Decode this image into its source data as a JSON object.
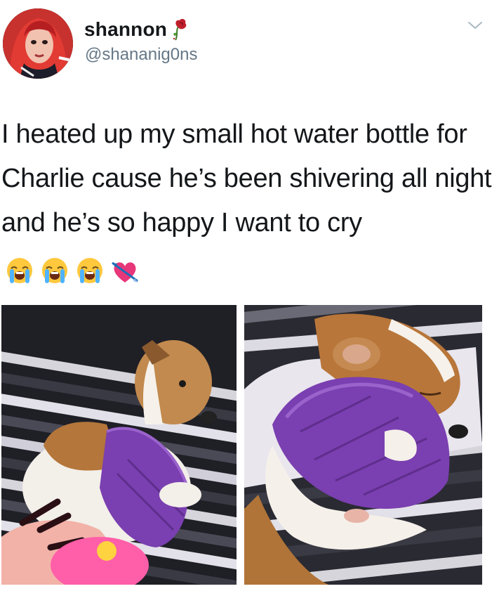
{
  "tweet": {
    "display_name": "shannon",
    "handle": "@shananig0ns",
    "text": "I heated up my small hot water bottle for Charlie cause he’s been shivering all night and he’s so happy I want to cry"
  },
  "icons": {
    "name_emoji": "rose-icon",
    "menu": "chevron-down-icon",
    "emojis": [
      "loudly-crying-face-icon",
      "loudly-crying-face-icon",
      "loudly-crying-face-icon",
      "heart-with-arrow-icon"
    ]
  },
  "colors": {
    "text": "#14171a",
    "handle": "#657786",
    "bottle_cover": "#7a3fb0"
  }
}
